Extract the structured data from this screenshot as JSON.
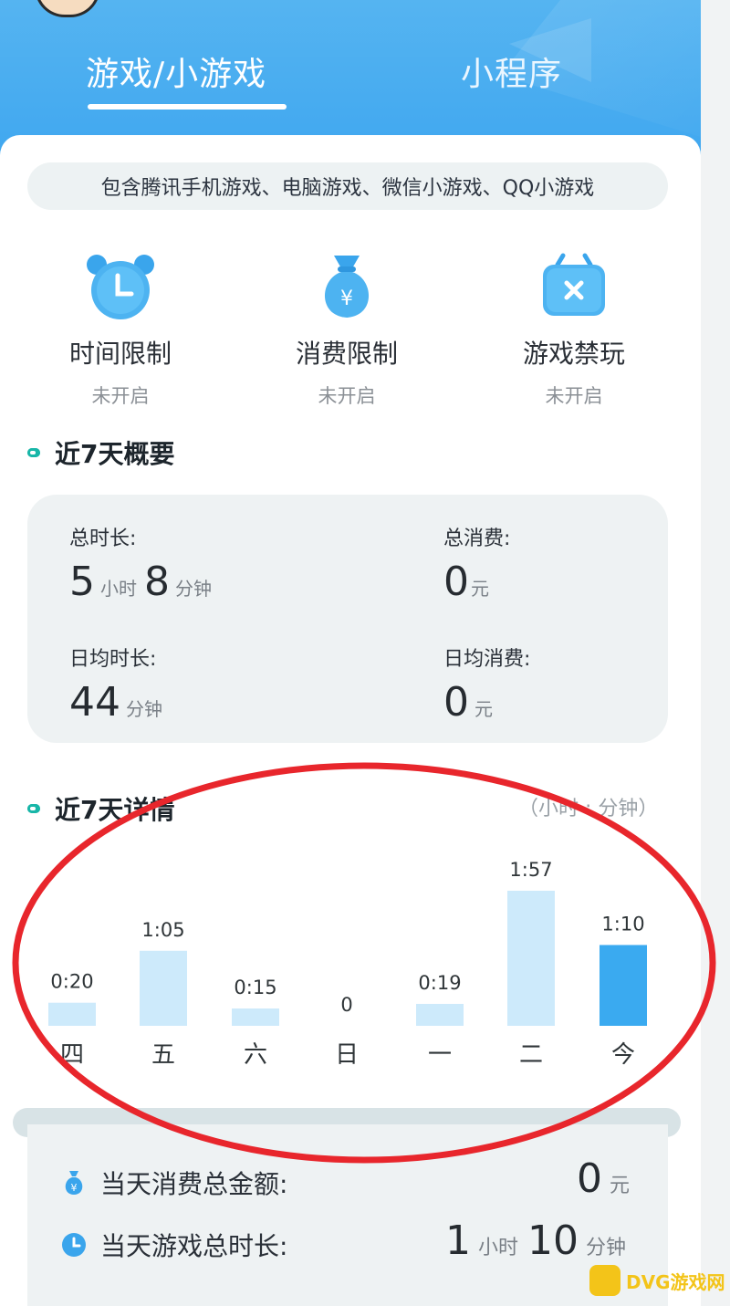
{
  "tabs": [
    {
      "label": "游戏/小游戏",
      "active": true
    },
    {
      "label": "小程序",
      "active": false
    }
  ],
  "notice": "包含腾讯手机游戏、电脑游戏、微信小游戏、QQ小游戏",
  "controls": [
    {
      "icon": "alarm-clock-icon",
      "label": "时间限制",
      "status": "未开启"
    },
    {
      "icon": "money-bag-icon",
      "label": "消费限制",
      "status": "未开启"
    },
    {
      "icon": "game-block-icon",
      "label": "游戏禁玩",
      "status": "未开启"
    }
  ],
  "summary": {
    "title": "近7天概要",
    "total_time_label": "总时长:",
    "total_time_hours": "5",
    "hours_unit": "小时",
    "total_time_minutes": "8",
    "minutes_unit": "分钟",
    "total_spend_label": "总消费:",
    "total_spend_value": "0",
    "yuan_unit": "元",
    "daily_time_label": "日均时长:",
    "daily_time_minutes": "44",
    "daily_spend_label": "日均消费:",
    "daily_spend_value": "0"
  },
  "details": {
    "title": "近7天详情",
    "unit_note": "（小时 : 分钟）"
  },
  "chart_data": {
    "type": "bar",
    "categories": [
      "四",
      "五",
      "六",
      "日",
      "一",
      "二",
      "今"
    ],
    "values": [
      20,
      65,
      15,
      0,
      19,
      117,
      70
    ],
    "value_labels": [
      "0:20",
      "1:05",
      "0:15",
      "0",
      "0:19",
      "1:57",
      "1:10"
    ],
    "highlight_index": 6,
    "colors": {
      "normal": "#cdeafb",
      "highlight": "#3aaaf0",
      "highlight_label": "#3aaaf0"
    }
  },
  "today": {
    "spend_icon": "money-bag-icon",
    "spend_label": "当天消费总金额:",
    "spend_value": "0",
    "spend_unit": "元",
    "time_icon": "clock-icon",
    "time_label": "当天游戏总时长:",
    "time_hours": "1",
    "hours_unit": "小时",
    "time_minutes": "10",
    "minutes_unit": "分钟"
  },
  "watermark": "DVG游戏网",
  "colors": {
    "accent": "#3ea6ef",
    "annotation": "#e8262c"
  }
}
